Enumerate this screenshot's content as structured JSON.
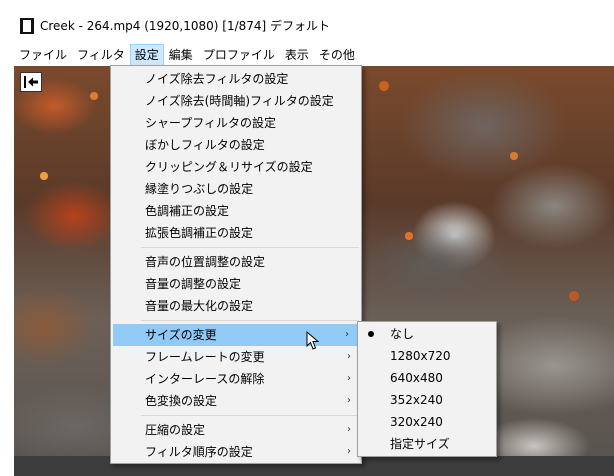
{
  "window": {
    "title": "Creek - 264.mp4 (1920,1080)  [1/874]  デフォルト"
  },
  "menubar": {
    "items": [
      {
        "label": "ファイル"
      },
      {
        "label": "フィルタ"
      },
      {
        "label": "設定"
      },
      {
        "label": "編集"
      },
      {
        "label": "プロファイル"
      },
      {
        "label": "表示"
      },
      {
        "label": "その他"
      }
    ]
  },
  "settings_menu": {
    "group1": [
      {
        "label": "ノイズ除去フィルタの設定"
      },
      {
        "label": "ノイズ除去(時間軸)フィルタの設定"
      },
      {
        "label": "シャープフィルタの設定"
      },
      {
        "label": "ぼかしフィルタの設定"
      },
      {
        "label": "クリッピング＆リサイズの設定"
      },
      {
        "label": "縁塗りつぶしの設定"
      },
      {
        "label": "色調補正の設定"
      },
      {
        "label": "拡張色調補正の設定"
      }
    ],
    "group2": [
      {
        "label": "音声の位置調整の設定"
      },
      {
        "label": "音量の調整の設定"
      },
      {
        "label": "音量の最大化の設定"
      }
    ],
    "group3": [
      {
        "label": "サイズの変更",
        "arrow": "›"
      },
      {
        "label": "フレームレートの変更",
        "arrow": "›"
      },
      {
        "label": "インターレースの解除",
        "arrow": "›"
      },
      {
        "label": "色変換の設定",
        "arrow": "›"
      }
    ],
    "group4": [
      {
        "label": "圧縮の設定",
        "arrow": "›"
      },
      {
        "label": "フィルタ順序の設定",
        "arrow": "›"
      }
    ]
  },
  "size_submenu": {
    "items": [
      {
        "label": "なし",
        "selected": true
      },
      {
        "label": "1280x720"
      },
      {
        "label": "640x480"
      },
      {
        "label": "352x240"
      },
      {
        "label": "320x240"
      },
      {
        "label": "指定サイズ"
      }
    ]
  },
  "icons": {
    "app": "film-icon",
    "back": "collapse-left-icon",
    "cursor": "mouse-pointer-icon"
  },
  "colors": {
    "menu_highlight": "#91c9f7",
    "menubar_active": "#cde8ff",
    "menu_background": "#f2f2f2"
  }
}
